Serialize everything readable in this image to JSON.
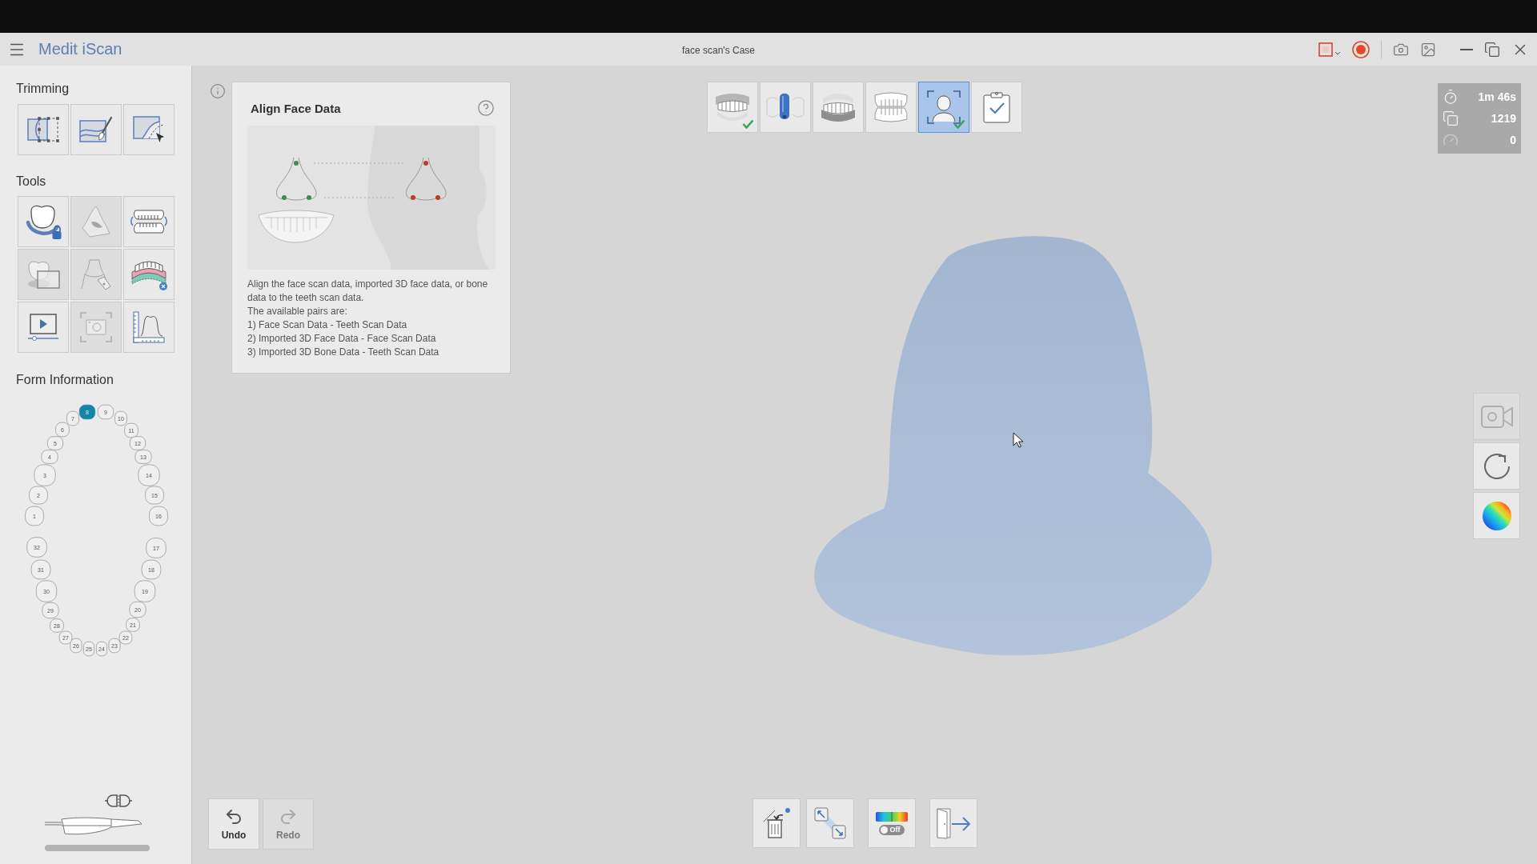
{
  "title_bar": {
    "logo": "Medit iScan",
    "case_title": "face scan's Case"
  },
  "sidebar": {
    "trimming": {
      "title": "Trimming",
      "buttons": [
        {
          "kind": "lasso"
        },
        {
          "kind": "brush"
        },
        {
          "kind": "pointer"
        }
      ]
    },
    "tools": {
      "title": "Tools",
      "buttons": [
        {
          "kind": "lock",
          "disabled": false
        },
        {
          "kind": "nose",
          "disabled": true
        },
        {
          "kind": "occlusion",
          "disabled": false
        },
        {
          "kind": "overlay",
          "disabled": true
        },
        {
          "kind": "marker",
          "disabled": true
        },
        {
          "kind": "gingiva",
          "disabled": false
        },
        {
          "kind": "video",
          "disabled": false
        },
        {
          "kind": "snapshot",
          "disabled": true
        },
        {
          "kind": "measure",
          "disabled": false
        }
      ]
    },
    "form_information": {
      "title": "Form Information",
      "teeth": [
        {
          "label": "1",
          "selected": false
        },
        {
          "label": "2",
          "selected": false
        },
        {
          "label": "3",
          "selected": false
        },
        {
          "label": "4",
          "selected": false
        },
        {
          "label": "5",
          "selected": false
        },
        {
          "label": "6",
          "selected": false
        },
        {
          "label": "7",
          "selected": false
        },
        {
          "label": "8",
          "selected": true
        },
        {
          "label": "9",
          "selected": false
        },
        {
          "label": "10",
          "selected": false
        },
        {
          "label": "11",
          "selected": false
        },
        {
          "label": "12",
          "selected": false
        },
        {
          "label": "13",
          "selected": false
        },
        {
          "label": "14",
          "selected": false
        },
        {
          "label": "15",
          "selected": false
        },
        {
          "label": "16",
          "selected": false
        },
        {
          "label": "17",
          "selected": false
        },
        {
          "label": "18",
          "selected": false
        },
        {
          "label": "19",
          "selected": false
        },
        {
          "label": "20",
          "selected": false
        },
        {
          "label": "21",
          "selected": false
        },
        {
          "label": "22",
          "selected": false
        },
        {
          "label": "23",
          "selected": false
        },
        {
          "label": "24",
          "selected": false
        },
        {
          "label": "25",
          "selected": false
        },
        {
          "label": "26",
          "selected": false
        },
        {
          "label": "27",
          "selected": false
        },
        {
          "label": "28",
          "selected": false
        },
        {
          "label": "29",
          "selected": false
        },
        {
          "label": "30",
          "selected": false
        },
        {
          "label": "31",
          "selected": false
        },
        {
          "label": "32",
          "selected": false
        }
      ]
    }
  },
  "guide_panel": {
    "title": "Align Face Data",
    "description": "Align the face scan data, imported 3D face data, or bone data to the teeth scan data.",
    "pairs_intro": "The available pairs are:",
    "pairs": [
      "1) Face Scan Data - Teeth Scan Data",
      "2) Imported 3D Face Data - Face Scan Data",
      "3) Imported 3D Bone Data - Teeth Scan Data"
    ]
  },
  "step_toolbar": {
    "steps": [
      {
        "kind": "upper",
        "selected": false,
        "completed": true
      },
      {
        "kind": "scanbody",
        "selected": false,
        "completed": false
      },
      {
        "kind": "lower",
        "selected": false,
        "completed": false
      },
      {
        "kind": "bite",
        "selected": false,
        "completed": false
      },
      {
        "kind": "face",
        "selected": true,
        "completed": true
      },
      {
        "kind": "review",
        "selected": false,
        "completed": false
      }
    ]
  },
  "scan_stats": [
    {
      "kind": "time",
      "value": "1m 46s"
    },
    {
      "kind": "frames",
      "value": "1219"
    },
    {
      "kind": "speed",
      "value": "0"
    }
  ],
  "view_buttons": [
    {
      "kind": "recorder",
      "disabled": true
    },
    {
      "kind": "rotate",
      "disabled": false
    },
    {
      "kind": "colormap",
      "disabled": false
    }
  ],
  "history": [
    {
      "label": "Undo",
      "disabled": false
    },
    {
      "label": "Redo",
      "disabled": true
    }
  ],
  "bottom_toolbar": {
    "groups": [
      {
        "buttons": [
          {
            "kind": "delete"
          },
          {
            "kind": "resize"
          }
        ]
      },
      {
        "buttons": [
          {
            "kind": "colormap",
            "toggle": {
              "label": "Off",
              "on": false
            }
          }
        ]
      },
      {
        "buttons": [
          {
            "kind": "exit"
          }
        ]
      }
    ]
  }
}
